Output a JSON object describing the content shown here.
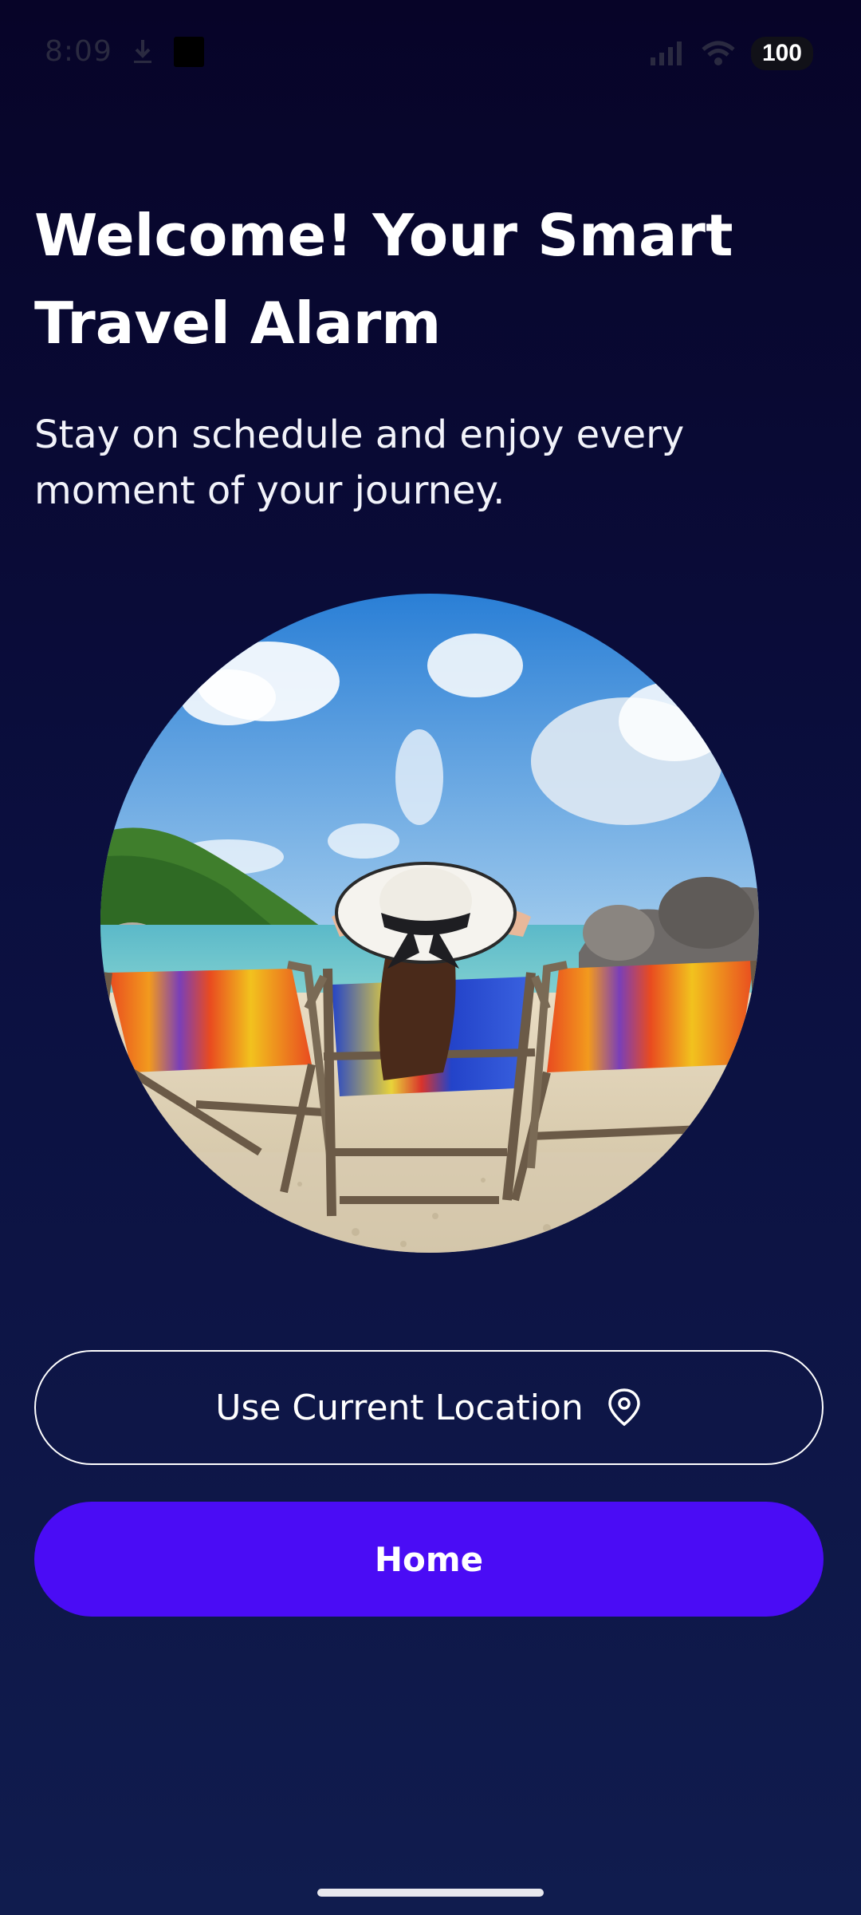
{
  "status_bar": {
    "time": "8:09",
    "battery": "100",
    "icons": [
      "download-icon",
      "square-icon",
      "signal-icon",
      "wifi-icon",
      "battery-icon"
    ]
  },
  "welcome": {
    "title": "Welcome! Your Smart Travel Alarm",
    "subtitle": "Stay on schedule and enjoy every moment of your journey."
  },
  "hero": {
    "image": "beach-lounge-chairs-illustration"
  },
  "actions": {
    "location_label": "Use Current Location",
    "location_icon": "location-pin-icon",
    "home_label": "Home"
  },
  "colors": {
    "background_top": "#070428",
    "background_bottom": "#101c4e",
    "accent": "#4a0cf5",
    "text": "#ffffff"
  }
}
